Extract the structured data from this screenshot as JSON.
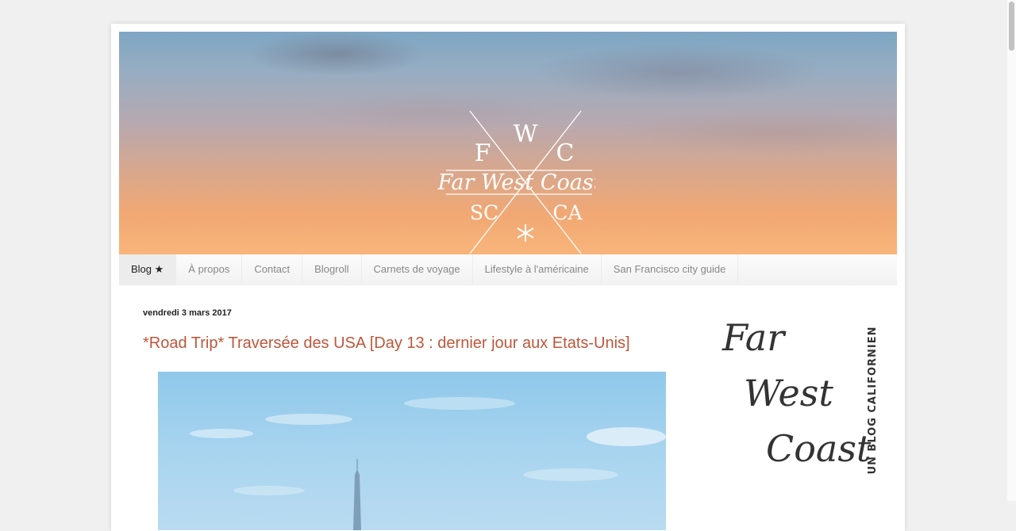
{
  "header": {
    "logo": {
      "letter_top": "W",
      "letter_left": "F",
      "letter_right": "C",
      "name": "Far West Coast",
      "letter_bottom_left": "SC",
      "letter_bottom_right": "CA"
    }
  },
  "nav": {
    "items": [
      {
        "label": "Blog ★"
      },
      {
        "label": "À propos"
      },
      {
        "label": "Contact"
      },
      {
        "label": "Blogroll"
      },
      {
        "label": "Carnets de voyage"
      },
      {
        "label": "Lifestyle à l'américaine"
      },
      {
        "label": "San Francisco city guide"
      }
    ]
  },
  "post": {
    "date": "vendredi 3 mars 2017",
    "title": "*Road Trip* Traversée des USA [Day 13 : dernier jour aux Etats-Unis]"
  },
  "sidebar": {
    "logo": {
      "line1": "Far",
      "line2": "West",
      "line3": "Coast",
      "tagline": "UN BLOG CALIFORNIEN"
    }
  },
  "colors": {
    "title": "#c0563a",
    "nav_text": "#888888",
    "nav_active_bg": "#ececec"
  }
}
